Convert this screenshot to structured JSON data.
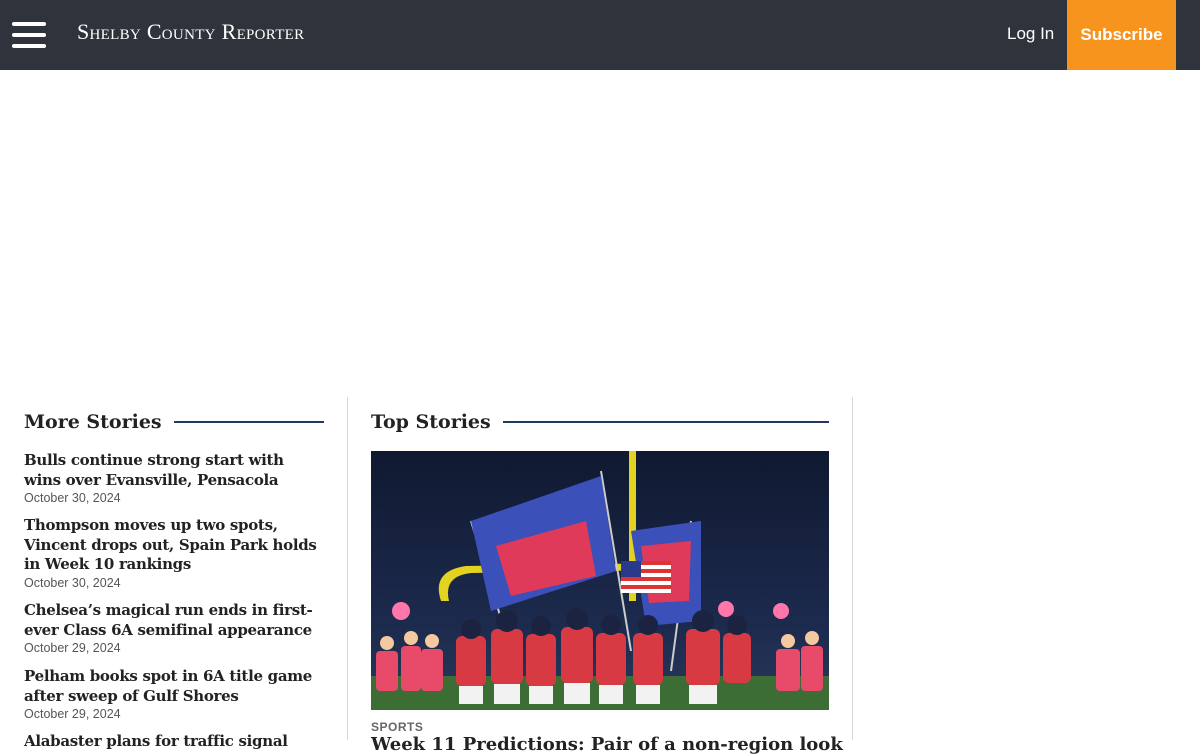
{
  "header": {
    "logo_text": "Shelby County Reporter",
    "login_label": "Log In",
    "subscribe_label": "Subscribe",
    "menu_icon": "hamburger-icon",
    "colors": {
      "bar": "#2f333b",
      "subscribe": "#f7941d",
      "rule": "#1f3a5f"
    }
  },
  "more_stories": {
    "heading": "More Stories",
    "items": [
      {
        "title": "Bulls continue strong start with wins over Evansville, Pensacola",
        "date": "October 30, 2024"
      },
      {
        "title": "Thompson moves up two spots, Vincent drops out, Spain Park holds in Week 10 rankings",
        "date": "October 30, 2024"
      },
      {
        "title": "Chelsea’s magical run ends in first-ever Class 6A semifinal appearance",
        "date": "October 29, 2024"
      },
      {
        "title": "Pelham books spot in 6A title game after sweep of Gulf Shores",
        "date": "October 29, 2024"
      },
      {
        "title": "Alabaster plans for traffic signal"
      }
    ]
  },
  "top_stories": {
    "heading": "Top Stories",
    "feature": {
      "image": "football-team-running-with-flags-photo",
      "category": "SPORTS",
      "title": "Week 11 Predictions: Pair of a non-region look"
    }
  }
}
